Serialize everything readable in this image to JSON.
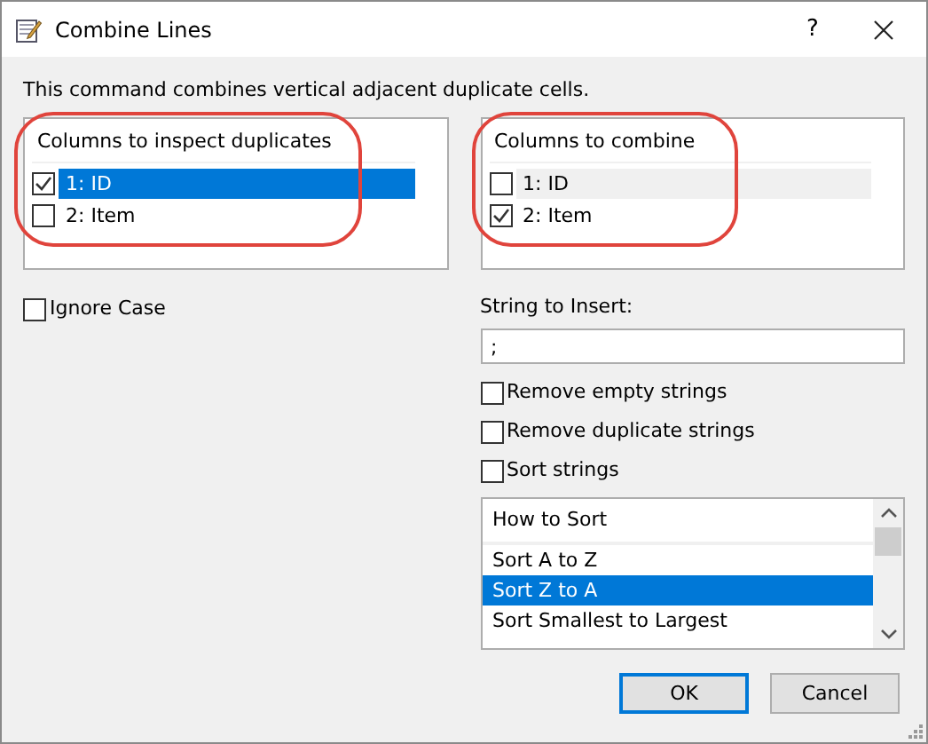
{
  "window": {
    "title": "Combine Lines",
    "help": "?"
  },
  "description": "This command combines vertical adjacent duplicate cells.",
  "lists": [
    {
      "header": "Columns to inspect duplicates",
      "highlighted": true,
      "items": [
        {
          "label": "1: ID",
          "checked": true,
          "selected": true
        },
        {
          "label": "2: Item",
          "checked": false,
          "selected": false
        }
      ]
    },
    {
      "header": "Columns to combine",
      "highlighted": true,
      "items": [
        {
          "label": "1: ID",
          "checked": false,
          "selected": false
        },
        {
          "label": "2: Item",
          "checked": true,
          "selected": false
        }
      ]
    }
  ],
  "ignore_case": {
    "label": "Ignore Case",
    "checked": false
  },
  "string_to_insert": {
    "label": "String to Insert:",
    "value": ";"
  },
  "options": [
    {
      "label": "Remove empty strings",
      "checked": false
    },
    {
      "label": "Remove duplicate strings",
      "checked": false
    },
    {
      "label": "Sort strings",
      "checked": false
    }
  ],
  "sort_list": {
    "header": "How to Sort",
    "items": [
      {
        "label": "Sort A to Z",
        "selected": false
      },
      {
        "label": "Sort Z to A",
        "selected": true
      },
      {
        "label": "Sort Smallest to Largest",
        "selected": false
      }
    ]
  },
  "buttons": [
    {
      "label": "OK",
      "default": true
    },
    {
      "label": "Cancel",
      "default": false
    }
  ]
}
